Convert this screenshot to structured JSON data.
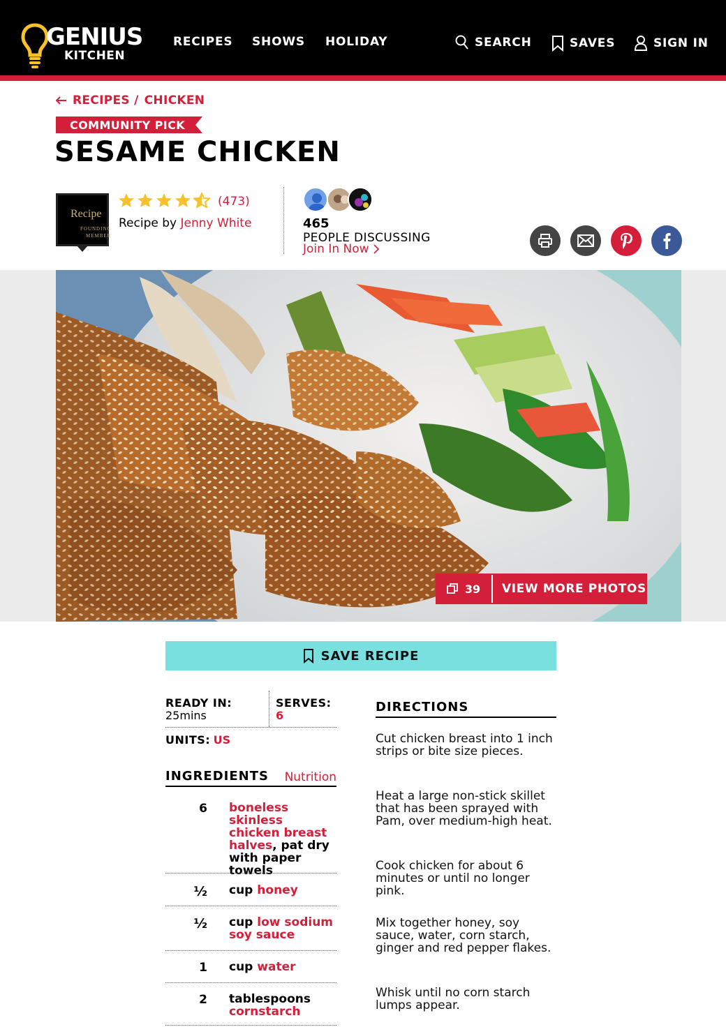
{
  "header": {
    "logo_genius": "GENIUS",
    "logo_kitchen": "KITCHEN",
    "nav": [
      "RECIPES",
      "SHOWS",
      "HOLIDAY"
    ],
    "search": "SEARCH",
    "saves": "SAVES",
    "sign_in": "SIGN IN"
  },
  "breadcrumb": {
    "root": "RECIPES /",
    "current": "CHICKEN"
  },
  "badge": "COMMUNITY PICK",
  "title": "SESAME CHICKEN",
  "author_badge": {
    "line1": "Recipe",
    "line2": "FOUNDING",
    "line3": "MEMBER"
  },
  "rating": {
    "stars": 4.5,
    "count": "(473)"
  },
  "recipe_by": {
    "prefix": "Recipe by ",
    "author": "Jenny White"
  },
  "discussion": {
    "count": "465",
    "label": "PEOPLE DISCUSSING",
    "join": "Join In Now"
  },
  "share": [
    "print-icon",
    "email-icon",
    "pinterest-icon",
    "facebook-icon"
  ],
  "photo": {
    "count": "39",
    "view_more": "VIEW MORE PHOTOS"
  },
  "save_recipe": "SAVE RECIPE",
  "details": {
    "ready_label": "READY IN:",
    "ready_value": "25mins",
    "serves_label": "SERVES:",
    "serves_value": "6",
    "units_label": "UNITS:",
    "units_value": "US"
  },
  "ingredients_header": "INGREDIENTS",
  "nutrition_link": "Nutrition",
  "ingredients": [
    {
      "qty": "6",
      "red": "boneless skinless chicken breast halves",
      "rest": ", pat dry with paper towels",
      "pre": ""
    },
    {
      "qty": "½",
      "pre": "cup ",
      "red": "honey",
      "rest": ""
    },
    {
      "qty": "½",
      "pre": "cup ",
      "red": "low sodium soy sauce",
      "rest": ""
    },
    {
      "qty": "1",
      "pre": "cup ",
      "red": "water",
      "rest": ""
    },
    {
      "qty": "2",
      "pre": "tablespoons ",
      "red": "cornstarch",
      "rest": ""
    }
  ],
  "directions_header": "DIRECTIONS",
  "directions": [
    "Cut chicken breast into 1 inch strips or bite size pieces.",
    "Heat a large non-stick skillet that has been sprayed with Pam, over medium-high heat.",
    "Cook chicken for about 6 minutes or until no longer pink.",
    "Mix together honey, soy sauce, water, corn starch, ginger and red pepper flakes.",
    "Whisk until no corn starch lumps appear."
  ],
  "colors": {
    "brand_red": "#d31f3a",
    "save_teal": "#7adfdf",
    "logo_yellow": "#f6c12b"
  }
}
